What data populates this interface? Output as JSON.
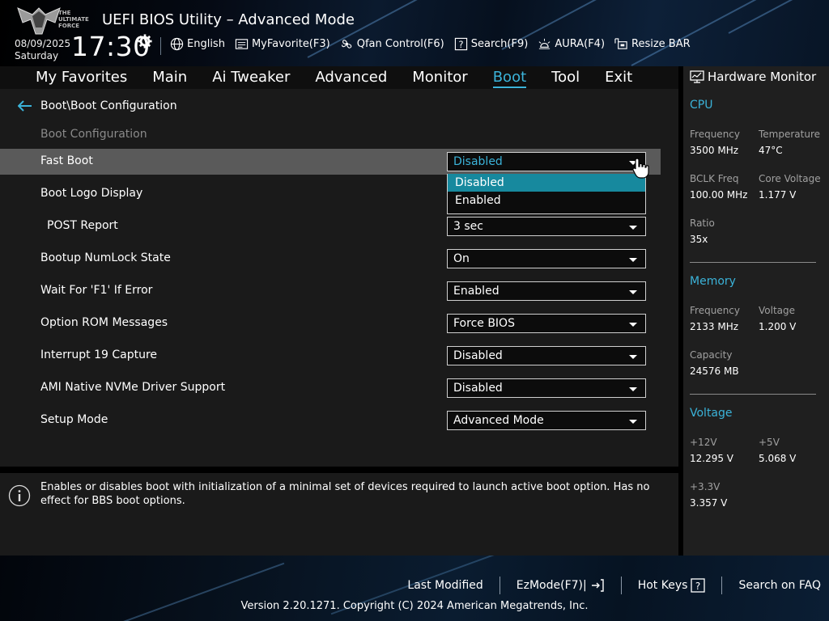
{
  "header": {
    "logo_text": [
      "THE",
      "ULTIMATE",
      "FORCE"
    ],
    "title": "UEFI BIOS Utility – Advanced Mode",
    "date": "08/09/2025",
    "day": "Saturday",
    "time": "17:30",
    "tools": [
      {
        "label": "English",
        "icon": "globe-icon"
      },
      {
        "label": "MyFavorite(F3)",
        "icon": "favorite-list-icon"
      },
      {
        "label": "Qfan Control(F6)",
        "icon": "fan-icon"
      },
      {
        "label": "Search(F9)",
        "icon": "search-help-icon"
      },
      {
        "label": "AURA(F4)",
        "icon": "aura-light-icon"
      },
      {
        "label": "Resize BAR",
        "icon": "resize-bar-icon"
      }
    ]
  },
  "nav": {
    "tabs": [
      "My Favorites",
      "Main",
      "Ai Tweaker",
      "Advanced",
      "Monitor",
      "Boot",
      "Tool",
      "Exit"
    ],
    "active": "Boot"
  },
  "main": {
    "breadcrumb": "Boot\\Boot Configuration",
    "section_label": "Boot Configuration",
    "settings": [
      {
        "label": "Fast Boot",
        "value": "Disabled"
      },
      {
        "label": "Boot Logo Display",
        "value": ""
      },
      {
        "label": "POST Report",
        "value": "3 sec"
      },
      {
        "label": "Bootup NumLock State",
        "value": "On"
      },
      {
        "label": "Wait For 'F1' If Error",
        "value": "Enabled"
      },
      {
        "label": "Option ROM Messages",
        "value": "Force BIOS"
      },
      {
        "label": "Interrupt 19 Capture",
        "value": "Disabled"
      },
      {
        "label": "AMI Native NVMe Driver Support",
        "value": "Disabled"
      },
      {
        "label": "Setup Mode",
        "value": "Advanced Mode"
      }
    ],
    "dropdown_options": [
      "Disabled",
      "Enabled"
    ]
  },
  "help": {
    "text": "Enables or disables boot with initialization of a minimal set of devices required to launch active boot option. Has no effect for BBS boot options."
  },
  "hw_monitor": {
    "title": "Hardware Monitor",
    "cpu": {
      "heading": "CPU",
      "frequency_label": "Frequency",
      "frequency": "3500 MHz",
      "temperature_label": "Temperature",
      "temperature": "47°C",
      "bclk_label": "BCLK Freq",
      "bclk": "100.00 MHz",
      "core_voltage_label": "Core Voltage",
      "core_voltage": "1.177 V",
      "ratio_label": "Ratio",
      "ratio": "35x"
    },
    "memory": {
      "heading": "Memory",
      "frequency_label": "Frequency",
      "frequency": "2133 MHz",
      "voltage_label": "Voltage",
      "voltage": "1.200 V",
      "capacity_label": "Capacity",
      "capacity": "24576 MB"
    },
    "voltage": {
      "heading": "Voltage",
      "v12_label": "+12V",
      "v12": "12.295 V",
      "v5_label": "+5V",
      "v5": "5.068 V",
      "v33_label": "+3.3V",
      "v33": "3.357 V"
    }
  },
  "footer": {
    "last_modified": "Last Modified",
    "ezmode": "EzMode(F7)|",
    "hot_keys": "Hot Keys",
    "hot_keys_key": "?",
    "faq": "Search on FAQ",
    "copyright": "Version 2.20.1271. Copyright (C) 2024 American Megatrends, Inc."
  },
  "colors": {
    "accent": "#3bb3d9",
    "highlight": "#17899e",
    "panel": "#1a1a1a"
  }
}
